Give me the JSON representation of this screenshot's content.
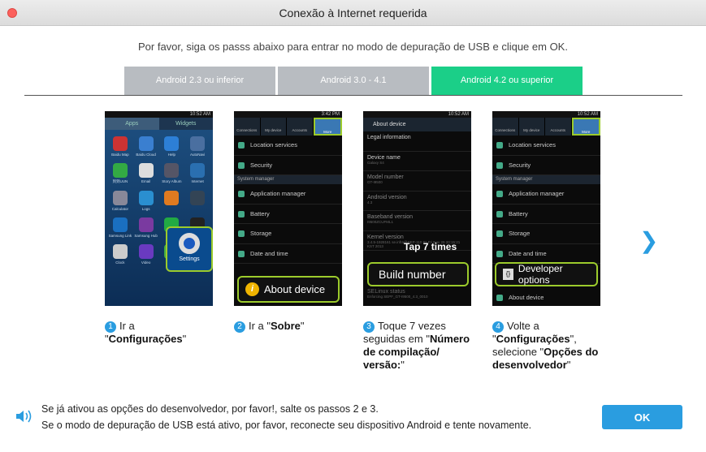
{
  "window": {
    "title": "Conexão à Internet requerida"
  },
  "instruction": "Por favor, siga os passs abaixo para entrar no modo de depuração de USB e clique em OK.",
  "tabs": [
    {
      "label": "Android 2.3 ou inferior",
      "active": false
    },
    {
      "label": "Android 3.0 - 4.1",
      "active": false
    },
    {
      "label": "Android 4.2 ou superior",
      "active": true
    }
  ],
  "phones": {
    "p1": {
      "time": "10:52 AM",
      "tabs": [
        "Apps",
        "Widgets"
      ],
      "apps": [
        "Baidu Map",
        "Baidu Cloud",
        "Help",
        "AutoNavi",
        "到到UUN",
        "Email",
        "Story Album",
        "Internet",
        "Calculator",
        "Logs",
        "",
        "",
        "Samsung Link",
        "Samsung Hub",
        "",
        "",
        "Clock",
        "Video",
        "Phone",
        ""
      ],
      "callout": "Settings"
    },
    "p2": {
      "time": "3:42 PM",
      "tabs": [
        "Connections",
        "My device",
        "Accounts",
        "More"
      ],
      "items": [
        "Location services",
        "Security"
      ],
      "section": "System manager",
      "items2": [
        "Application manager",
        "Battery",
        "Storage",
        "Date and time"
      ],
      "callout": "About device"
    },
    "p3": {
      "time": "10:52 AM",
      "header": "About device",
      "rows": [
        {
          "t": "Legal information",
          "s": ""
        },
        {
          "t": "Device name",
          "s": "Galaxy S4"
        },
        {
          "t": "Model number",
          "s": "GT-I9500"
        },
        {
          "t": "Android version",
          "s": "4.3"
        },
        {
          "t": "Baseband version",
          "s": "I9500ZCUFML1"
        },
        {
          "t": "Kernel version",
          "s": "3.4.5-1928161 se.infra@SEP-110 #1 Fri Nov 29 20:15:21 KST 2013"
        }
      ],
      "tap": "Tap 7 times",
      "callout": "Build number",
      "last": "SELinux status",
      "last_sub": "Enforcing SEPF_GT-I9500_4.3_0010"
    },
    "p4": {
      "time": "10:52 AM",
      "tabs": [
        "Connections",
        "My device",
        "Accounts",
        "More"
      ],
      "items": [
        "Location services",
        "Security"
      ],
      "section": "System manager",
      "items2": [
        "Application manager",
        "Battery",
        "Storage",
        "Date and time"
      ],
      "callout": "Developer options",
      "last": "About device"
    }
  },
  "steps": [
    {
      "n": "1",
      "pre": "Ir a \"",
      "b": "Configurações",
      "post": "\"",
      "b2": "",
      "post2": ""
    },
    {
      "n": "2",
      "pre": "Ir a \"",
      "b": "Sobre",
      "post": "\"",
      "b2": "",
      "post2": ""
    },
    {
      "n": "3",
      "pre": "Toque 7 vezes seguidas em \"",
      "b": "Número de compilação/ versão:",
      "post": "\"",
      "b2": "",
      "post2": ""
    },
    {
      "n": "4",
      "pre": "Volte a \"",
      "b": "Configurações",
      "post": "\", selecione \"",
      "b2": "Opções do desenvolvedor",
      "post2": "\""
    }
  ],
  "footer": {
    "line1": "Se já ativou as opções do desenvolvedor, por favor!, salte os passos 2 e 3.",
    "line2": "Se o modo de depuração de USB está ativo, por favor, reconecte seu dispositivo Android e tente novamente.",
    "ok": "OK"
  },
  "colors": {
    "accent": "#2a9de0",
    "active_tab": "#1bcf88",
    "inactive_tab": "#b8bcc1",
    "highlight": "#9ccb2c"
  }
}
